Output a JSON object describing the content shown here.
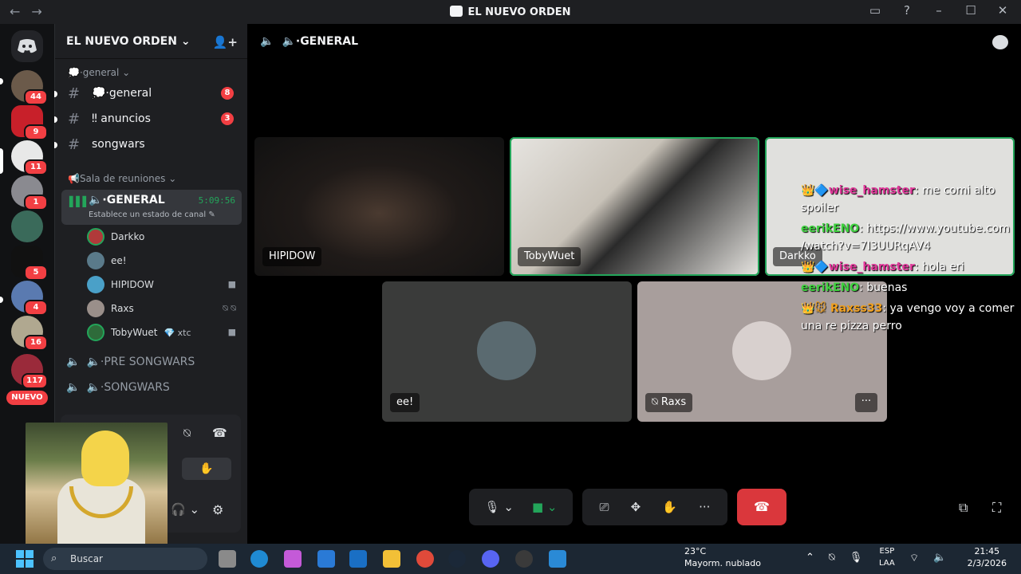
{
  "window": {
    "title": "EL NUEVO ORDEN"
  },
  "servers": {
    "badges": [
      "44",
      "9",
      "11",
      "1",
      "5",
      "4",
      "16",
      "117"
    ],
    "new_label": "NUEVO"
  },
  "guild": {
    "name": "EL NUEVO ORDEN ⌄"
  },
  "channel_list": {
    "category_general": "💭·general ⌄",
    "text_channels": [
      {
        "name": "💭·general",
        "badge": "8"
      },
      {
        "name": "‼ anuncios",
        "badge": "3"
      },
      {
        "name": "songwars",
        "badge": ""
      }
    ],
    "category_voice": "📢Sala de reuniones ⌄",
    "active_voice": {
      "name": "🔈·GENERAL",
      "timer": "5:09:56",
      "status": "Establece un estado de canal ✎"
    },
    "members": [
      {
        "name": "Darkko",
        "extra": "",
        "color": "#b03a3a"
      },
      {
        "name": "ee!",
        "extra": "",
        "color": "#5a7a8a"
      },
      {
        "name": "HIPIDOW",
        "extra": "",
        "color": "#4aa0c8"
      },
      {
        "name": "Raxs",
        "extra": "",
        "color": "#9a8f8a"
      },
      {
        "name": "TobyWuet",
        "extra": "💎 xtc",
        "color": "#2e6b3a"
      }
    ],
    "other_voice": [
      {
        "name": "🔈·PRE SONGWARS"
      },
      {
        "name": "🔈·SONGWARS"
      }
    ]
  },
  "stage": {
    "header": "🔈·GENERAL",
    "tiles": [
      {
        "label": "HIPIDOW"
      },
      {
        "label": "TobyWuet"
      },
      {
        "label": "Darkko"
      },
      {
        "label": "ee!"
      },
      {
        "label": "⍉ Raxs"
      }
    ],
    "more_label": "···"
  },
  "chat_overlay": [
    {
      "user": "👑🔷wise_hamster",
      "text": ": me comi alto",
      "user_color": "#e0389a"
    },
    {
      "user": "",
      "text": "spoiler",
      "user_color": "#ffffff"
    },
    {
      "user": "eerikENO",
      "text": ": https://www.youtube.com",
      "user_color": "#3fd13f"
    },
    {
      "user": "",
      "text": "/watch?v=7I3UURqAV4",
      "user_color": "#ffffff"
    },
    {
      "user": "👑🔷wise_hamster",
      "text": ": hola eri",
      "user_color": "#e0389a"
    },
    {
      "user": "eerikENO",
      "text": ": buenas",
      "user_color": "#3fd13f"
    },
    {
      "user": "👑🐭 Raxss33",
      "text": ": ya vengo voy a comer",
      "user_color": "#f0a020"
    },
    {
      "user": "",
      "text": "una re pizza perro",
      "user_color": "#ffffff"
    }
  ],
  "controls": {
    "mic": "🎙 ⌄",
    "camera": "■ ⌄",
    "share": "⎚",
    "activities": "✥",
    "soundboard": "✋",
    "more": "···",
    "hangup": "☎"
  },
  "taskbar": {
    "search_placeholder": "Buscar",
    "weather_temp": "23°C",
    "weather_desc": "Mayorm. nublado",
    "lang_1": "ESP",
    "lang_2": "LAA",
    "time": "21:45",
    "date": "2/3/2026"
  },
  "colors": {
    "speaking_green": "#23a55a",
    "hangup_red": "#da373c",
    "badge_red": "#f23f43"
  }
}
